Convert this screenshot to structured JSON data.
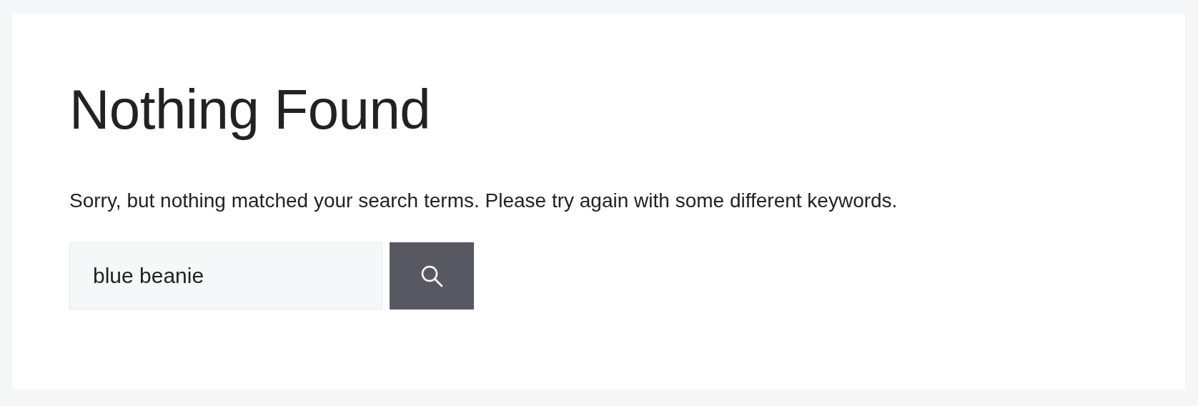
{
  "title": "Nothing Found",
  "message": "Sorry, but nothing matched your search terms. Please try again with some different keywords.",
  "search": {
    "value": "blue beanie"
  }
}
